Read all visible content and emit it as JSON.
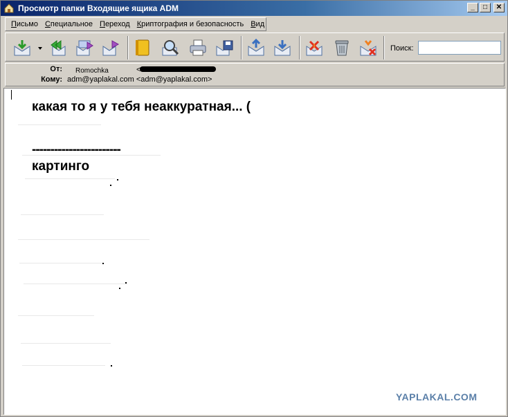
{
  "window": {
    "title": "Просмотр папки Входящие ящика ADM",
    "buttons": {
      "minimize": "_",
      "maximize": "□",
      "close": "✕"
    }
  },
  "menu": {
    "items": [
      {
        "first": "П",
        "rest": "исьмо"
      },
      {
        "first": "С",
        "rest": "пециальное"
      },
      {
        "first": "П",
        "rest": "ереход"
      },
      {
        "first": "К",
        "rest": "риптография и безопасность"
      },
      {
        "first": "В",
        "rest": "ид"
      }
    ]
  },
  "toolbar": {
    "icons": [
      "receive-icon",
      "reply-all-icon",
      "forward-icon",
      "forward-attachment-icon",
      "address-book-icon",
      "find-icon",
      "print-icon",
      "save-icon",
      "previous-message-icon",
      "next-message-icon",
      "delete-message-icon",
      "trash-icon",
      "delete-server-icon"
    ],
    "search_label": "Поиск:",
    "search_value": ""
  },
  "header": {
    "from_label": "От:",
    "from_name": "Romochka",
    "from_bracket": "<",
    "to_label": "Кому:",
    "to_value": "adm@yaplakal.com <adm@yaplakal.com>"
  },
  "message": {
    "line1": "какая то я у тебя неаккуратная... (",
    "line2": "------------------------",
    "line3": "картинго"
  },
  "watermark": "YAPLAKAL.COM",
  "colors": {
    "titlebar_start": "#0a246a",
    "titlebar_end": "#a6caf0",
    "chrome": "#d4d0c8",
    "watermark": "#5a7fa8"
  }
}
